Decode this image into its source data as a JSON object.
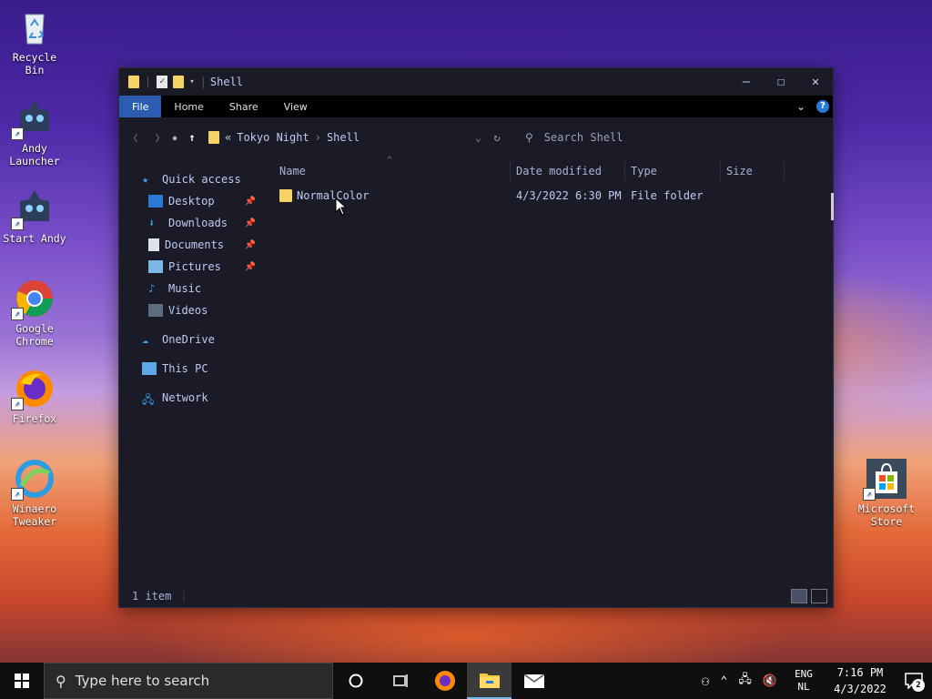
{
  "desktop": {
    "icons_left": [
      {
        "label": "Recycle\nBin",
        "icon": "recycle-bin-icon"
      },
      {
        "label": "Andy\nLauncher",
        "icon": "andy-launcher-icon"
      },
      {
        "label": "Start Andy",
        "icon": "start-andy-icon"
      },
      {
        "label": "Google\nChrome",
        "icon": "chrome-icon"
      },
      {
        "label": "Firefox",
        "icon": "firefox-icon"
      },
      {
        "label": "Winaero\nTweaker",
        "icon": "winaero-tweaker-icon"
      }
    ],
    "icon_right": {
      "label": "Microsoft\nStore",
      "icon": "microsoft-store-icon"
    }
  },
  "window": {
    "title": "Shell",
    "ribbon_tabs": [
      "File",
      "Home",
      "Share",
      "View"
    ],
    "active_tab": "File",
    "address": {
      "prefix": "«",
      "crumbs": [
        "Tokyo Night",
        "Shell"
      ],
      "separator": "›"
    },
    "search_placeholder": "Search Shell",
    "nav_pane": {
      "quick_access": "Quick access",
      "pinned": [
        {
          "label": "Desktop",
          "icon": "desktop-icon",
          "pinned": true
        },
        {
          "label": "Downloads",
          "icon": "downloads-icon",
          "pinned": true
        },
        {
          "label": "Documents",
          "icon": "documents-icon",
          "pinned": true
        },
        {
          "label": "Pictures",
          "icon": "pictures-icon",
          "pinned": true
        },
        {
          "label": "Music",
          "icon": "music-icon",
          "pinned": false
        },
        {
          "label": "Videos",
          "icon": "videos-icon",
          "pinned": false
        }
      ],
      "onedrive": "OneDrive",
      "this_pc": "This PC",
      "network": "Network"
    },
    "columns": [
      "Name",
      "Date modified",
      "Type",
      "Size"
    ],
    "files": [
      {
        "name": "NormalColor",
        "date": "4/3/2022 6:30 PM",
        "type": "File folder",
        "size": ""
      }
    ],
    "status": "1 item"
  },
  "taskbar": {
    "search_placeholder": "Type here to search",
    "lang_top": "ENG",
    "lang_bottom": "NL",
    "time": "7:16 PM",
    "date": "4/3/2022",
    "notification_count": "2"
  },
  "colors": {
    "accent": "#2b5cb0",
    "window_bg": "#1a1b26",
    "text": "#c0caf5",
    "folder": "#f6d365"
  }
}
